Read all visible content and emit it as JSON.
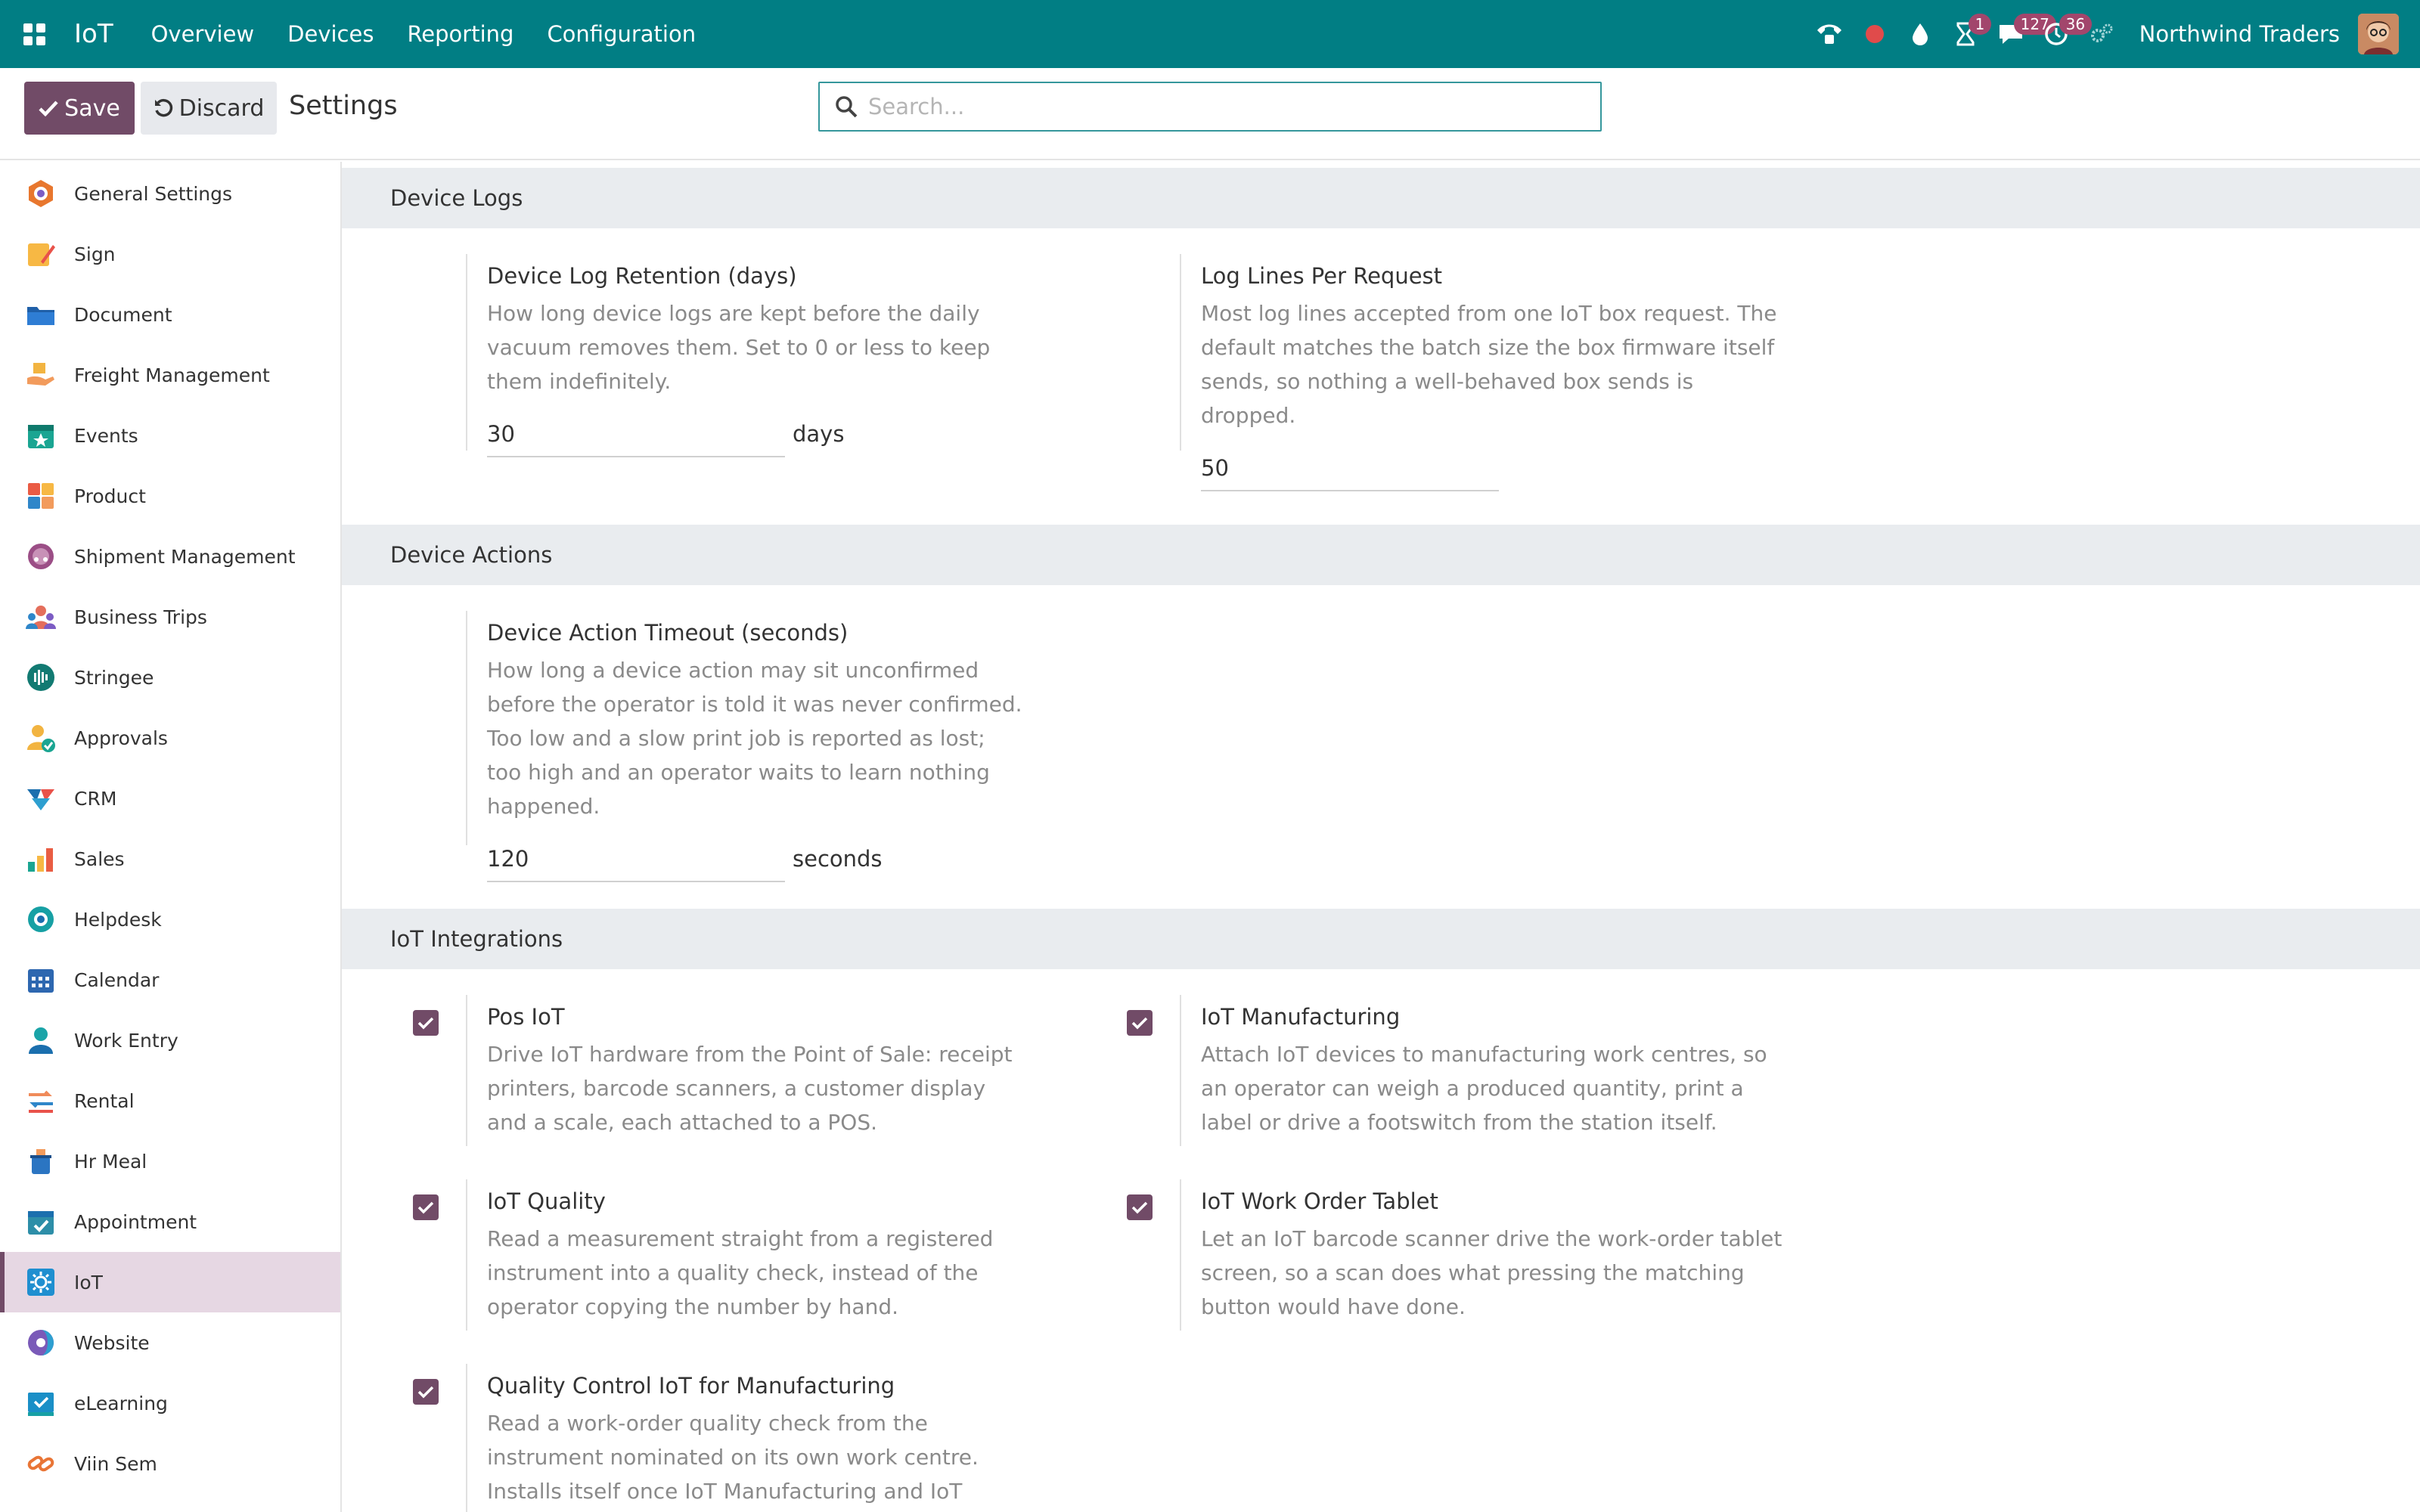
{
  "navbar": {
    "brand": "IoT",
    "menu": [
      "Overview",
      "Devices",
      "Reporting",
      "Configuration"
    ],
    "activity_badge": "1",
    "messages_badge": "127",
    "clock_badge": "36",
    "company": "Northwind Traders"
  },
  "control": {
    "save_label": "Save",
    "discard_label": "Discard",
    "title": "Settings",
    "search_placeholder": "Search..."
  },
  "sidebar": {
    "items": [
      {
        "label": "General Settings",
        "icon": "general-settings-icon",
        "color": "#e8772e"
      },
      {
        "label": "Sign",
        "icon": "sign-icon",
        "color": "#f7b844"
      },
      {
        "label": "Document",
        "icon": "document-icon",
        "color": "#1f5fa8"
      },
      {
        "label": "Freight Management",
        "icon": "freight-icon",
        "color": "#f29b5c"
      },
      {
        "label": "Events",
        "icon": "events-icon",
        "color": "#1aa592"
      },
      {
        "label": "Product",
        "icon": "product-icon",
        "color": "#ea5b44"
      },
      {
        "label": "Shipment Management",
        "icon": "shipment-icon",
        "color": "#9b4e86"
      },
      {
        "label": "Business Trips",
        "icon": "business-trips-icon",
        "color": "#e46e5b"
      },
      {
        "label": "Stringee",
        "icon": "stringee-icon",
        "color": "#127a72"
      },
      {
        "label": "Approvals",
        "icon": "approvals-icon",
        "color": "#f2b441"
      },
      {
        "label": "CRM",
        "icon": "crm-icon",
        "color": "#1b6fae"
      },
      {
        "label": "Sales",
        "icon": "sales-icon",
        "color": "#e95d43"
      },
      {
        "label": "Helpdesk",
        "icon": "helpdesk-icon",
        "color": "#17a0a4"
      },
      {
        "label": "Calendar",
        "icon": "calendar-icon",
        "color": "#2d67b0"
      },
      {
        "label": "Work Entry",
        "icon": "work-entry-icon",
        "color": "#1aa4a8"
      },
      {
        "label": "Rental",
        "icon": "rental-icon",
        "color": "#f08b5a"
      },
      {
        "label": "Hr Meal",
        "icon": "hr-meal-icon",
        "color": "#2b75c2"
      },
      {
        "label": "Appointment",
        "icon": "appointment-icon",
        "color": "#2d8ea8"
      },
      {
        "label": "IoT",
        "icon": "iot-icon",
        "color": "#1f8fd0"
      },
      {
        "label": "Website",
        "icon": "website-icon",
        "color": "#7a5ab8"
      },
      {
        "label": "eLearning",
        "icon": "elearning-icon",
        "color": "#1a8fc7"
      },
      {
        "label": "Viin Sem",
        "icon": "viin-sem-icon",
        "color": "#e97536"
      }
    ]
  },
  "sections": {
    "logs": {
      "title": "Device Logs",
      "retention": {
        "label": "Device Log Retention (days)",
        "help": "How long device logs are kept before the daily vacuum removes them. Set to 0 or less to keep them indefinitely.",
        "value": "30",
        "unit": "days"
      },
      "lines": {
        "label": "Log Lines Per Request",
        "help": "Most log lines accepted from one IoT box request. The default matches the batch size the box firmware itself sends, so nothing a well-behaved box sends is dropped.",
        "value": "50"
      }
    },
    "actions": {
      "title": "Device Actions",
      "timeout": {
        "label": "Device Action Timeout (seconds)",
        "help": "How long a device action may sit unconfirmed before the operator is told it was never confirmed. Too low and a slow print job is reported as lost; too high and an operator waits to learn nothing happened.",
        "value": "120",
        "unit": "seconds"
      }
    },
    "integrations": {
      "title": "IoT Integrations",
      "pos": {
        "label": "Pos IoT",
        "help": "Drive IoT hardware from the Point of Sale: receipt printers, barcode scanners, a customer display and a scale, each attached to a POS."
      },
      "mrp": {
        "label": "IoT Manufacturing",
        "help": "Attach IoT devices to manufacturing work centres, so an operator can weigh a produced quantity, print a label or drive a footswitch from the station itself."
      },
      "quality": {
        "label": "IoT Quality",
        "help": "Read a measurement straight from a registered instrument into a quality check, instead of the operator copying the number by hand."
      },
      "tablet": {
        "label": "IoT Work Order Tablet",
        "help": "Let an IoT barcode scanner drive the work-order tablet screen, so a scan does what pressing the matching button would have done."
      },
      "qc_mrp": {
        "label": "Quality Control IoT for Manufacturing",
        "help": "Read a work-order quality check from the instrument nominated on its own work centre. Installs itself once IoT Manufacturing and IoT Quality are both present; switch it"
      }
    }
  },
  "colors": {
    "navbar": "#017e84",
    "primary": "#714b67",
    "badge": "#a2466c",
    "section_header": "#e9ecef"
  }
}
